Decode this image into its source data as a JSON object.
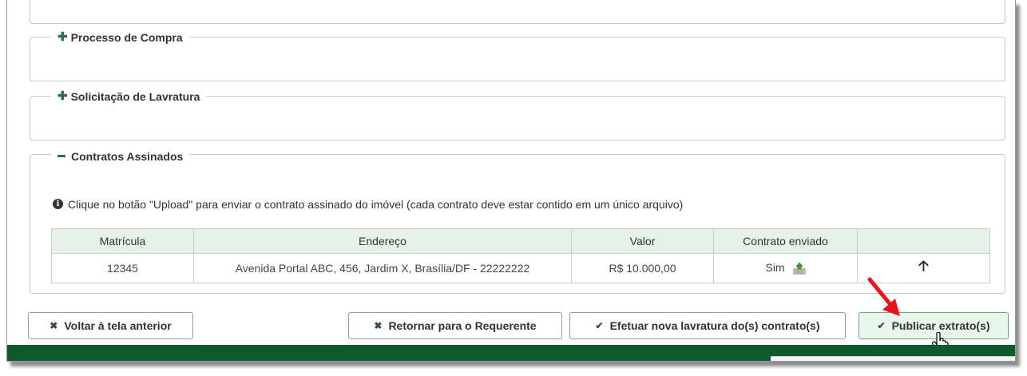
{
  "panels": {
    "purchase_process": {
      "label": "Processo de Compra"
    },
    "lavratura_request": {
      "label": "Solicitação de Lavratura"
    },
    "signed_contracts": {
      "label": "Contratos Assinados"
    }
  },
  "info_text": "Clique no botão \"Upload\" para enviar o contrato assinado do imóvel (cada contrato deve estar contido em um único arquivo)",
  "table": {
    "headers": [
      "Matrícula",
      "Endereço",
      "Valor",
      "Contrato enviado",
      ""
    ],
    "rows": [
      {
        "matricula": "12345",
        "endereco": "Avenida Portal ABC, 456, Jardim X, Brasília/DF - 22222222",
        "valor": "R$ 10.000,00",
        "contrato_enviado": "Sim"
      }
    ]
  },
  "buttons": {
    "back": "Voltar à tela anterior",
    "return_requester": "Retornar para o Requerente",
    "new_lavratura": "Efetuar nova lavratura do(s) contrato(s)",
    "publish": "Publicar extrato(s)"
  },
  "icons": {
    "plus": "plus-icon",
    "minus": "minus-icon",
    "info": "info-circle-icon",
    "upload": "upload-file-icon",
    "arrow_up": "arrow-up-icon",
    "times": "times-icon",
    "check": "check-icon",
    "hand_cursor": "hand-pointer-icon",
    "annotation_arrow": "red-arrow-icon"
  },
  "colors": {
    "accent_green": "#0e5a2c",
    "table_header_bg": "#e6f2e9",
    "annotation_red": "#e8141b"
  }
}
